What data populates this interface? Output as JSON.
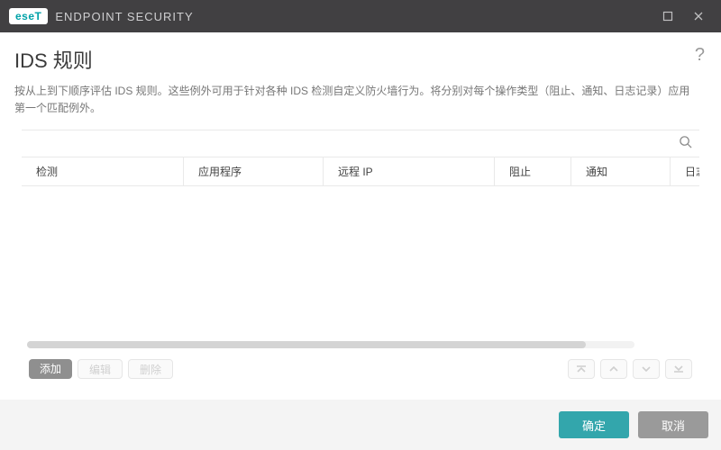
{
  "window": {
    "brand_badge": "eseT",
    "brand_text": "ENDPOINT SECURITY"
  },
  "page": {
    "title": "IDS 规则",
    "help": "?",
    "description": "按从上到下顺序评估 IDS 规则。这些例外可用于针对各种 IDS 检测自定义防火墙行为。将分别对每个操作类型（阻止、通知、日志记录）应用第一个匹配例外。"
  },
  "table": {
    "columns": {
      "detection": "检测",
      "application": "应用程序",
      "remote_ip": "远程 IP",
      "block": "阻止",
      "notify": "通知",
      "log": "日志"
    },
    "rows": []
  },
  "actions": {
    "add": "添加",
    "edit": "编辑",
    "delete": "删除"
  },
  "footer": {
    "ok": "确定",
    "cancel": "取消"
  }
}
